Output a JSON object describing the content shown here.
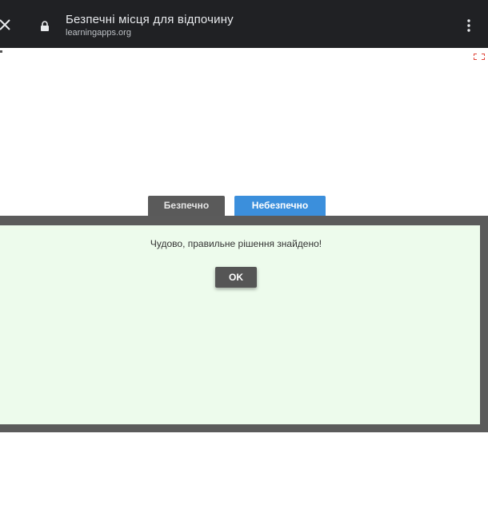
{
  "browser": {
    "title": "Безпечні місця для відпочину",
    "url": "learningapps.org"
  },
  "icons": {
    "close": "close-icon",
    "lock": "lock-icon",
    "menu": "more-vert-icon",
    "fullscreen": "fullscreen-icon"
  },
  "categories": {
    "safe_label": "Безпечно",
    "unsafe_label": "Небезпечно"
  },
  "dialog": {
    "message": "Чудово, правильне рішення знайдено!",
    "ok_label": "OK"
  },
  "colors": {
    "browser_bar": "#202124",
    "category_safe": "#5a5a5a",
    "category_unsafe": "#3b8fdc",
    "dialog_background": "#edfbec",
    "dialog_border": "#5b5b5b",
    "fullscreen_icon": "#e0453a"
  }
}
